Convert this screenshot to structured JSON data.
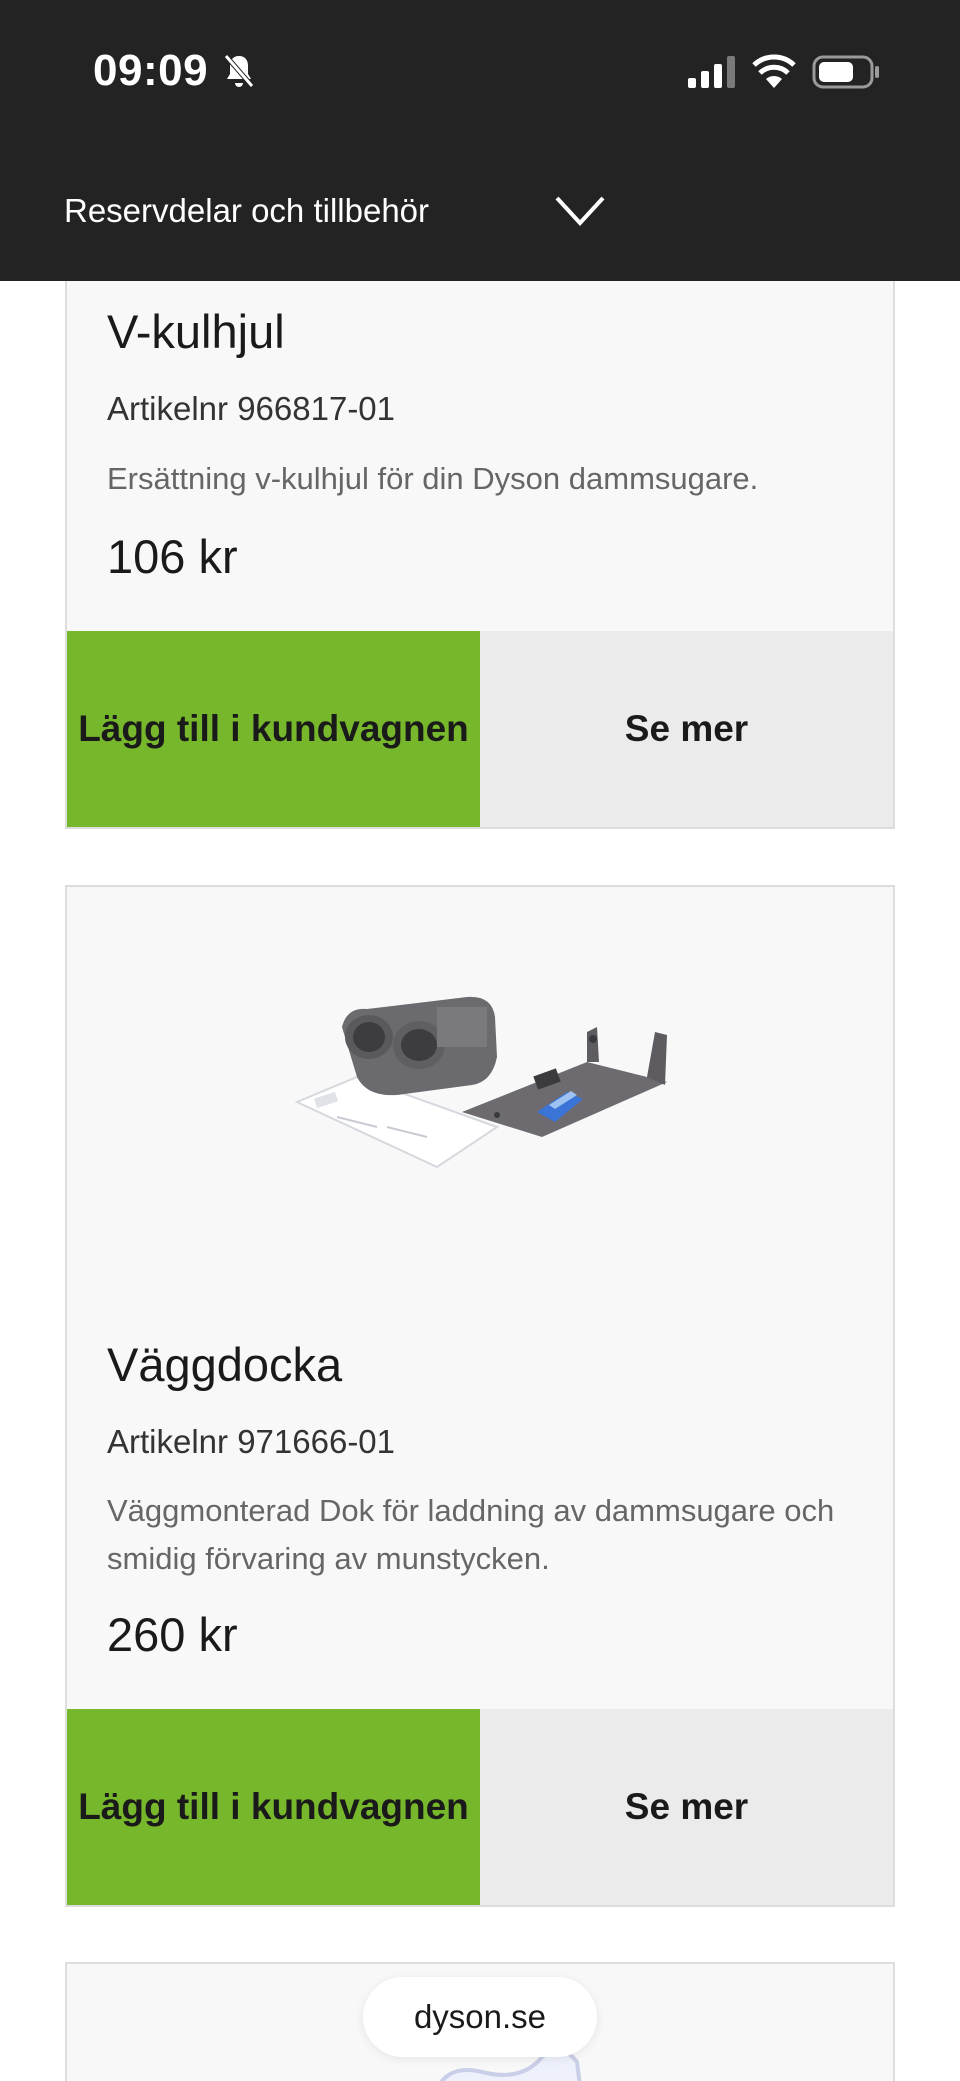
{
  "status_bar": {
    "time": "09:09"
  },
  "header": {
    "title": "Reservdelar och tillbehör"
  },
  "products": [
    {
      "title": "V-kulhjul",
      "article_no": "Artikelnr 966817-01",
      "description": "Ersättning v-kulhjul för din Dyson dammsugare.",
      "price": "106 kr",
      "add_to_cart": "Lägg till i kundvagnen",
      "see_more": "Se mer"
    },
    {
      "title": "Väggdocka",
      "article_no": "Artikelnr 971666-01",
      "description": "Väggmonterad Dok för laddning av dammsugare och smidig förvaring av munstycken.",
      "price": "260 kr",
      "add_to_cart": "Lägg till i kundvagnen",
      "see_more": "Se mer"
    }
  ],
  "browser": {
    "url": "dyson.se"
  },
  "colors": {
    "header_bg": "#232323",
    "add_button": "#77b72b",
    "see_more_button": "#ebebeb"
  }
}
